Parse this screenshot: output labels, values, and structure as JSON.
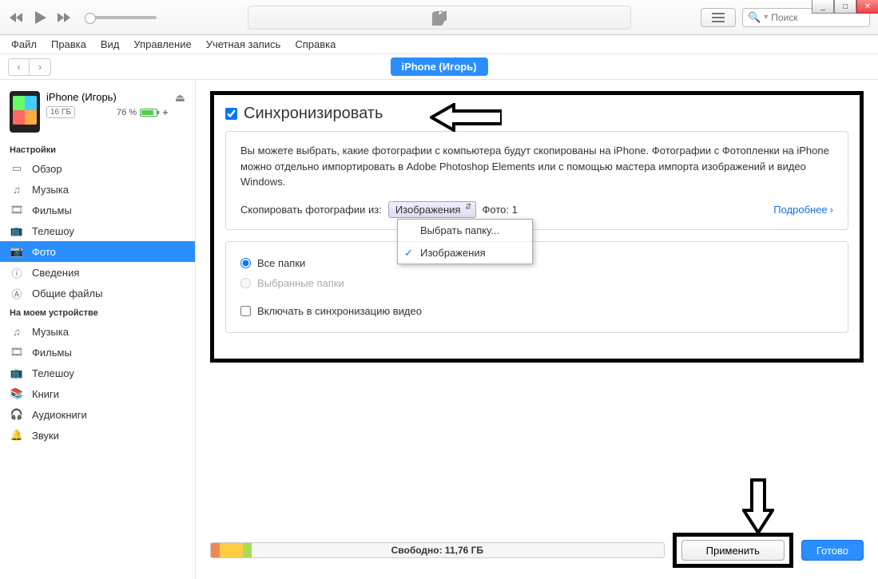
{
  "window_controls": {
    "min": "_",
    "max": "□",
    "close": "✕"
  },
  "search": {
    "placeholder": "Поиск"
  },
  "menu": [
    "Файл",
    "Правка",
    "Вид",
    "Управление",
    "Учетная запись",
    "Справка"
  ],
  "device_pill": "iPhone (Игорь)",
  "device": {
    "name": "iPhone (Игорь)",
    "storage": "16 ГБ",
    "battery_pct": "76 %"
  },
  "sections": {
    "settings_title": "Настройки",
    "on_device_title": "На моем устройстве"
  },
  "settings_items": [
    {
      "label": "Обзор"
    },
    {
      "label": "Музыка"
    },
    {
      "label": "Фильмы"
    },
    {
      "label": "Телешоу"
    },
    {
      "label": "Фото",
      "active": true
    },
    {
      "label": "Сведения"
    },
    {
      "label": "Общие файлы"
    }
  ],
  "device_items": [
    {
      "label": "Музыка"
    },
    {
      "label": "Фильмы"
    },
    {
      "label": "Телешоу"
    },
    {
      "label": "Книги"
    },
    {
      "label": "Аудиокниги"
    },
    {
      "label": "Звуки"
    }
  ],
  "sync": {
    "title": "Синхронизировать",
    "description": "Вы можете выбрать, какие фотографии с компьютера будут скопированы на iPhone. Фотографии с Фотопленки на iPhone можно отдельно импортировать в Adobe Photoshop Elements или с помощью мастера импорта изображений и видео Windows.",
    "copy_label": "Скопировать фотографии из:",
    "select_value": "Изображения",
    "photo_count": "Фото: 1",
    "more": "Подробнее",
    "dropdown": {
      "choose": "Выбрать папку...",
      "images": "Изображения"
    },
    "radio_all": "Все папки",
    "radio_selected": "Выбранные папки",
    "include_video": "Включать в синхронизацию видео"
  },
  "footer": {
    "free_label": "Свободно: 11,76 ГБ",
    "apply": "Применить",
    "done": "Готово"
  }
}
